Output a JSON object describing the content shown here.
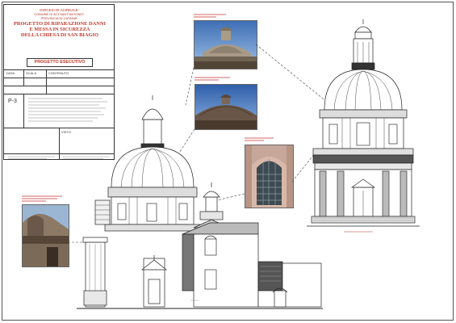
{
  "titleblock": {
    "diocese": "DIOCESI DI ACIREALE",
    "municipality": "COMUNE DI ACI SANT'ANTONIO",
    "province": "PROVINCIA DI CATANIA",
    "project_title_1": "PROGETTO DI RIPARAZIONE DANNI",
    "project_title_2": "E MESSA IN SICUREZZA",
    "project_title_3": "DELLA CHIESA DI SAN BIAGIO",
    "stage": "PROGETTO ESECUTIVO",
    "sheet_number": "P-3",
    "field_date": "DATA",
    "field_scale": "SCALA",
    "field_content": "CONTENUTO",
    "field_checked": "VISTO"
  }
}
